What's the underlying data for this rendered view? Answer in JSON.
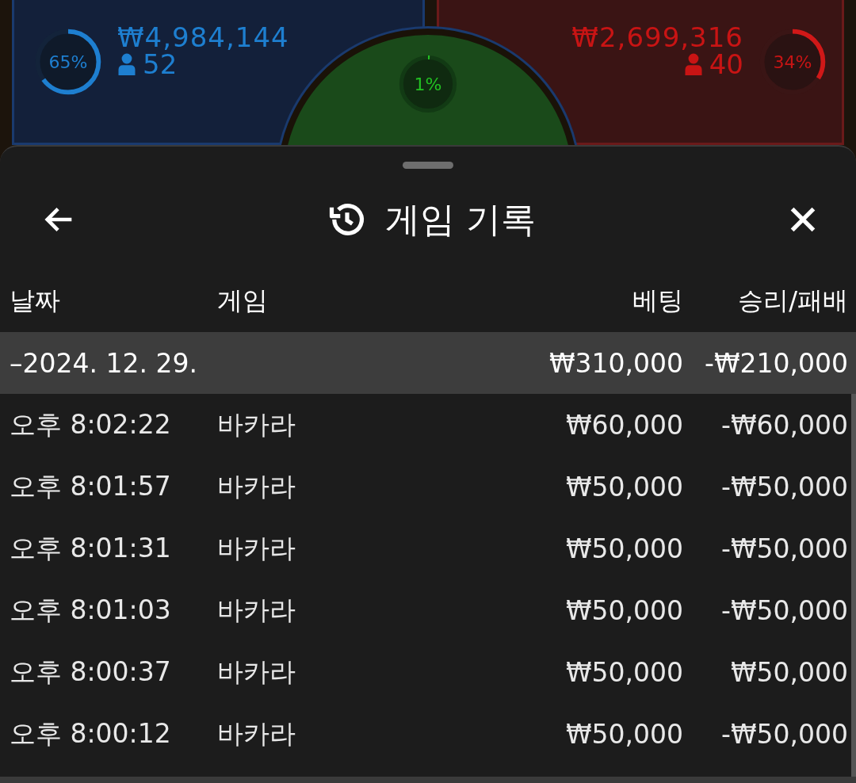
{
  "table_stats": {
    "player": {
      "percent": "65%",
      "level": 0.65,
      "amount": "₩4,984,144",
      "count": "52"
    },
    "tie": {
      "percent": "1%",
      "level": 0.01
    },
    "banker": {
      "percent": "34%",
      "level": 0.34,
      "amount": "₩2,699,316",
      "count": "40"
    }
  },
  "sheet": {
    "title": "게임 기록",
    "columns": [
      "날짜",
      "게임",
      "베팅",
      "승리/패배"
    ],
    "group": {
      "date": "–2024. 12. 29.",
      "bet": "₩310,000",
      "result": "-₩210,000"
    },
    "rows": [
      {
        "time": "오후 8:02:22",
        "game": "바카라",
        "bet": "₩60,000",
        "result": "-₩60,000"
      },
      {
        "time": "오후 8:01:57",
        "game": "바카라",
        "bet": "₩50,000",
        "result": "-₩50,000"
      },
      {
        "time": "오후 8:01:31",
        "game": "바카라",
        "bet": "₩50,000",
        "result": "-₩50,000"
      },
      {
        "time": "오후 8:01:03",
        "game": "바카라",
        "bet": "₩50,000",
        "result": "-₩50,000"
      },
      {
        "time": "오후 8:00:37",
        "game": "바카라",
        "bet": "₩50,000",
        "result": "₩50,000"
      },
      {
        "time": "오후 8:00:12",
        "game": "바카라",
        "bet": "₩50,000",
        "result": "-₩50,000"
      }
    ]
  }
}
